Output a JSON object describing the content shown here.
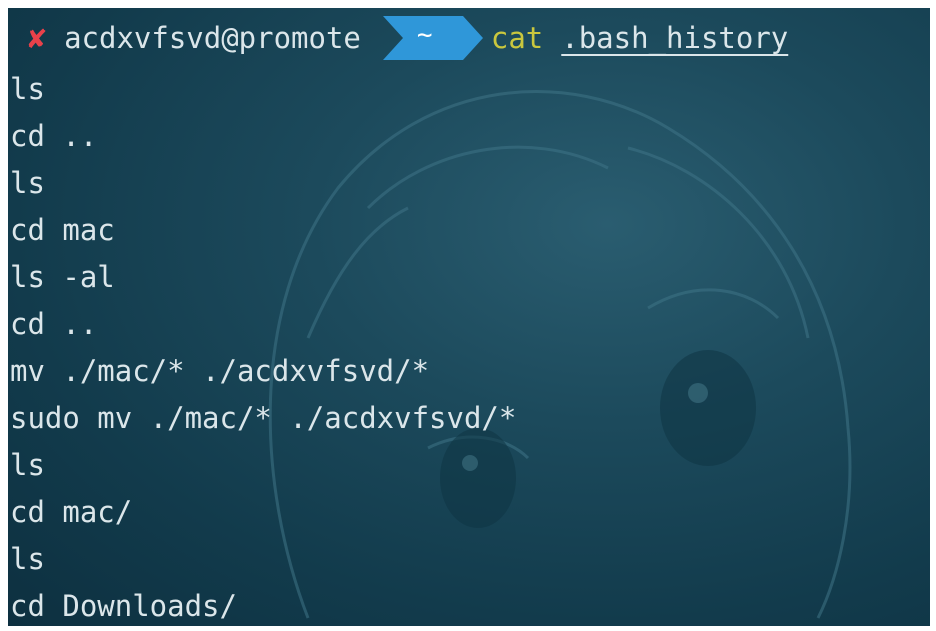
{
  "terminal": {
    "prompt": {
      "status_icon": "x-mark-icon",
      "user_host": "acdxvfsvd@promote",
      "directory": "~",
      "command": "cat",
      "argument": ".bash_history"
    },
    "output_lines": [
      "ls",
      "cd ..",
      "ls",
      "cd mac",
      "ls -al",
      "cd ..",
      "mv ./mac/* ./acdxvfsvd/*",
      "sudo mv ./mac/* ./acdxvfsvd/*",
      "ls",
      "cd mac/",
      "ls",
      "cd Downloads/"
    ]
  },
  "colors": {
    "background": "#1c4a5c",
    "status_error": "#e8414a",
    "dir_segment": "#2f97d9",
    "command": "#c9c73e",
    "text": "#dbe6ea"
  }
}
